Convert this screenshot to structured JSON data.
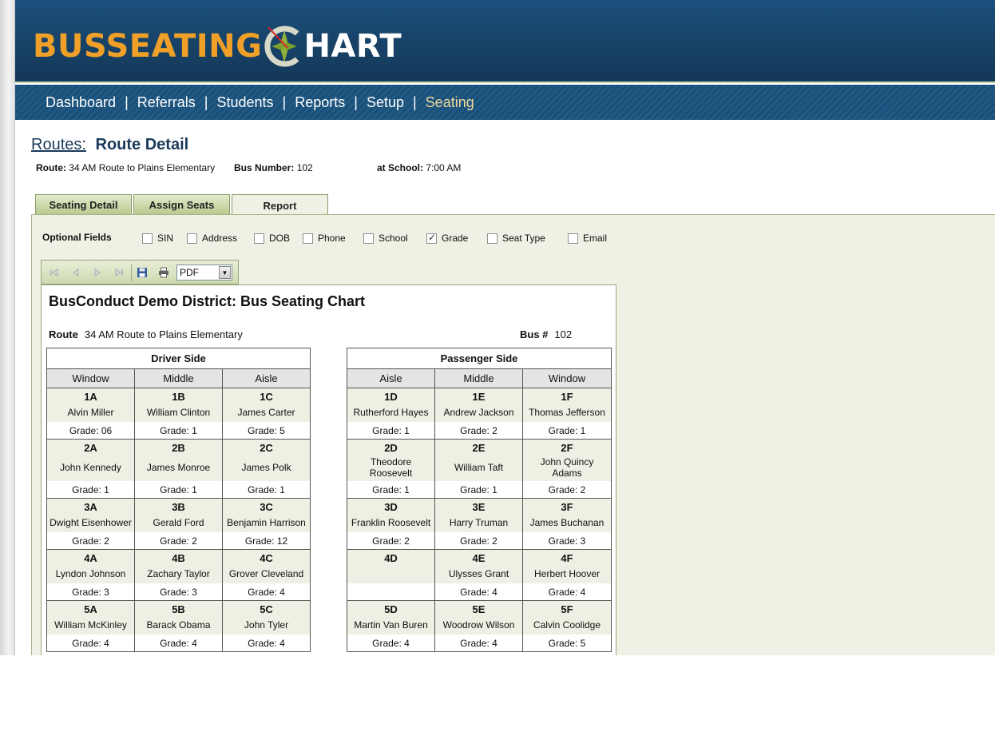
{
  "brand": {
    "part1": "BUSSEATING",
    "part2": "HART"
  },
  "nav": [
    {
      "label": "Dashboard",
      "active": false
    },
    {
      "label": "Referrals",
      "active": false
    },
    {
      "label": "Students",
      "active": false
    },
    {
      "label": "Reports",
      "active": false
    },
    {
      "label": "Setup",
      "active": false
    },
    {
      "label": "Seating",
      "active": true
    }
  ],
  "nav_separator": "|",
  "page": {
    "crumb": "Routes:",
    "title": "Route Detail"
  },
  "info": {
    "route_label": "Route:",
    "route_value": "34 AM Route to Plains Elementary",
    "bus_label": "Bus Number:",
    "bus_value": "102",
    "school_label": "at School:",
    "school_value": "7:00 AM"
  },
  "tabs": [
    {
      "label": "Seating Detail",
      "active": false
    },
    {
      "label": "Assign Seats",
      "active": false
    },
    {
      "label": "Report",
      "active": true
    }
  ],
  "optional_fields": {
    "label": "Optional Fields",
    "items": [
      {
        "label": "SIN",
        "checked": false
      },
      {
        "label": "Address",
        "checked": false
      },
      {
        "label": "DOB",
        "checked": false
      },
      {
        "label": "Phone",
        "checked": false
      },
      {
        "label": "School",
        "checked": false
      },
      {
        "label": "Grade",
        "checked": true
      },
      {
        "label": "Seat Type",
        "checked": false
      },
      {
        "label": "Email",
        "checked": false
      }
    ]
  },
  "toolbar": {
    "format": "PDF"
  },
  "report": {
    "title": "BusConduct Demo District: Bus Seating Chart",
    "route_label": "Route",
    "route_value": "34 AM Route to Plains Elementary",
    "bus_label": "Bus #",
    "bus_value": "102",
    "driver": {
      "heading": "Driver Side",
      "columns": [
        "Window",
        "Middle",
        "Aisle"
      ],
      "rows": [
        [
          {
            "seat": "1A",
            "name": "Alvin Miller",
            "grade": "Grade: 06"
          },
          {
            "seat": "1B",
            "name": "William Clinton",
            "grade": "Grade: 1"
          },
          {
            "seat": "1C",
            "name": "James  Carter",
            "grade": "Grade: 5"
          }
        ],
        [
          {
            "seat": "2A",
            "name": "John Kennedy",
            "grade": "Grade: 1"
          },
          {
            "seat": "2B",
            "name": "James Monroe",
            "grade": "Grade: 1"
          },
          {
            "seat": "2C",
            "name": "James Polk",
            "grade": "Grade: 1"
          }
        ],
        [
          {
            "seat": "3A",
            "name": "Dwight Eisenhower",
            "grade": "Grade: 2"
          },
          {
            "seat": "3B",
            "name": "Gerald Ford",
            "grade": "Grade: 2"
          },
          {
            "seat": "3C",
            "name": "Benjamin Harrison",
            "grade": "Grade: 12"
          }
        ],
        [
          {
            "seat": "4A",
            "name": "Lyndon Johnson",
            "grade": "Grade: 3"
          },
          {
            "seat": "4B",
            "name": "Zachary Taylor",
            "grade": "Grade: 3"
          },
          {
            "seat": "4C",
            "name": "Grover Cleveland",
            "grade": "Grade: 4"
          }
        ],
        [
          {
            "seat": "5A",
            "name": "William McKinley",
            "grade": "Grade: 4"
          },
          {
            "seat": "5B",
            "name": "Barack Obama",
            "grade": "Grade: 4"
          },
          {
            "seat": "5C",
            "name": "John Tyler",
            "grade": "Grade: 4"
          }
        ]
      ]
    },
    "passenger": {
      "heading": "Passenger Side",
      "columns": [
        "Aisle",
        "Middle",
        "Window"
      ],
      "rows": [
        [
          {
            "seat": "1D",
            "name": "Rutherford Hayes",
            "grade": "Grade: 1"
          },
          {
            "seat": "1E",
            "name": "Andrew  Jackson",
            "grade": "Grade: 2"
          },
          {
            "seat": "1F",
            "name": "Thomas Jefferson",
            "grade": "Grade: 1"
          }
        ],
        [
          {
            "seat": "2D",
            "name": "Theodore Roosevelt",
            "grade": "Grade: 1"
          },
          {
            "seat": "2E",
            "name": "William Taft",
            "grade": "Grade: 1"
          },
          {
            "seat": "2F",
            "name": "John Quincy Adams",
            "grade": "Grade: 2"
          }
        ],
        [
          {
            "seat": "3D",
            "name": "Franklin Roosevelt",
            "grade": "Grade: 2"
          },
          {
            "seat": "3E",
            "name": "Harry Truman",
            "grade": "Grade: 2"
          },
          {
            "seat": "3F",
            "name": "James Buchanan",
            "grade": "Grade: 3"
          }
        ],
        [
          {
            "seat": "4D",
            "name": "",
            "grade": ""
          },
          {
            "seat": "4E",
            "name": "Ulysses Grant",
            "grade": "Grade: 4"
          },
          {
            "seat": "4F",
            "name": "Herbert Hoover",
            "grade": "Grade: 4"
          }
        ],
        [
          {
            "seat": "5D",
            "name": "Martin Van Buren",
            "grade": "Grade: 4"
          },
          {
            "seat": "5E",
            "name": "Woodrow Wilson",
            "grade": "Grade: 4"
          },
          {
            "seat": "5F",
            "name": "Calvin Coolidge",
            "grade": "Grade: 5"
          }
        ]
      ]
    }
  }
}
